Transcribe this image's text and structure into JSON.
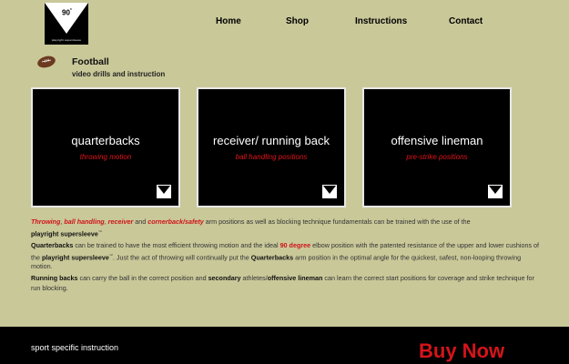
{
  "logo": {
    "number": "90",
    "sup": "°",
    "tagline": "playright supersleeve"
  },
  "nav": [
    {
      "label": "Home"
    },
    {
      "label": "Shop"
    },
    {
      "label": "Instructions"
    },
    {
      "label": "Contact"
    }
  ],
  "section": {
    "title": "Football",
    "subtitle": "video drills and instruction"
  },
  "cards": [
    {
      "title": "quarterbacks",
      "subtitle": "throwing motion"
    },
    {
      "title": "receiver/ running back",
      "subtitle": "ball handling positions"
    },
    {
      "title": "offensive lineman",
      "subtitle": "pre-strike positions"
    }
  ],
  "para1": {
    "r1": "Throwing",
    "sep1": ", ",
    "r2": "ball handling",
    "sep2": ", ",
    "r3": "receiver",
    "mid1": " and ",
    "r4": "cornerback/safety",
    "rest": " arm positions as well as blocking technique fundamentals can be trained with the use of the ",
    "brand": "playright supersleeve",
    "tm": "™"
  },
  "para2": {
    "b1": "Quarterbacks",
    "t1": " can be trained to have the most efficient throwing motion and the ideal ",
    "r1": "90 degree",
    "t2": " elbow position with the patented resistance of the upper and lower cushions of the ",
    "brand": "playright supersleeve",
    "tm": "™",
    "t3": ". Just the act of throwing will continually put the ",
    "b2": "Quarterbacks",
    "t4": " arm position in the optimal angle for the quickest, safest, non-looping throwing motion."
  },
  "para3": {
    "b1": "Running backs",
    "t1": " can carry the ball in the correct position and ",
    "b2": "secondary",
    "t2": " athletes/",
    "b3": "offensive lineman",
    "t3": "  can learn the correct start positions for coverage and strike technique for run blocking."
  },
  "footer": {
    "text": "sport specific instruction",
    "buy": "Buy Now"
  },
  "colors": {
    "background": "#c9c899",
    "accent_red": "#d01218",
    "card_bg": "#000000",
    "footer_bg": "#000000"
  }
}
